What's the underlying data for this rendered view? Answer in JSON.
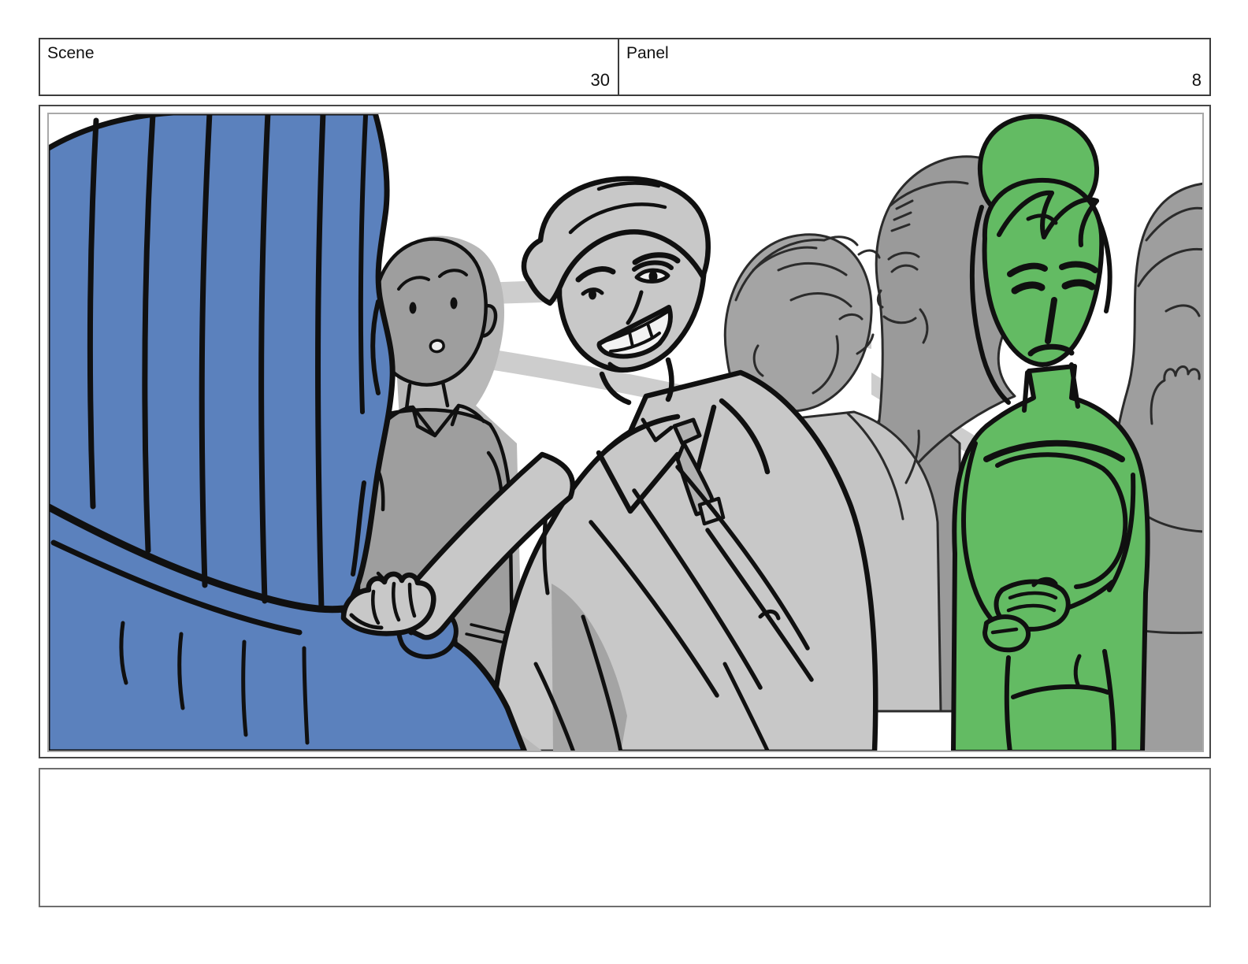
{
  "header": {
    "scene": {
      "label": "Scene",
      "value": "30"
    },
    "panel": {
      "label": "Panel",
      "value": "8"
    }
  },
  "canvas": {
    "description": "Storyboard sketch of a crowded reception: a blue-highlighted woman seen from behind, a grinning man in a suit reaching out to grab her hand, a startled bald bystander, two background guests chatting, a green-highlighted woman with a hair bun looking annoyed with hands clasped, and a partial figure at the right edge.",
    "characters": [
      {
        "name": "blue-woman-foreground",
        "pose": "back view, long hair, hand being grabbed"
      },
      {
        "name": "bald-bystander",
        "pose": "facing viewer, startled"
      },
      {
        "name": "suited-man",
        "pose": "leaning in, grinning, reaching out"
      },
      {
        "name": "background-guest-left",
        "pose": "profile facing right, smiling"
      },
      {
        "name": "background-guest-right",
        "pose": "profile facing left, balding, smiling"
      },
      {
        "name": "green-woman",
        "pose": "hair bun, annoyed, hands clasped"
      },
      {
        "name": "edge-figure-right",
        "pose": "partially visible at right edge"
      }
    ],
    "colors": {
      "blue": "#5b81bd",
      "green": "#63bb63",
      "suit_gray": "#c8c8c8",
      "mid_gray": "#9e9e9e",
      "back_gray": "#a4a4a4",
      "jacket_gray": "#c4c4c4",
      "dark_gray": "#9a9a9a",
      "shadow_gray": "#b8b8b8",
      "band_gray": "#cdcdcd",
      "outline": "#101010"
    }
  },
  "notes": {
    "value": ""
  }
}
